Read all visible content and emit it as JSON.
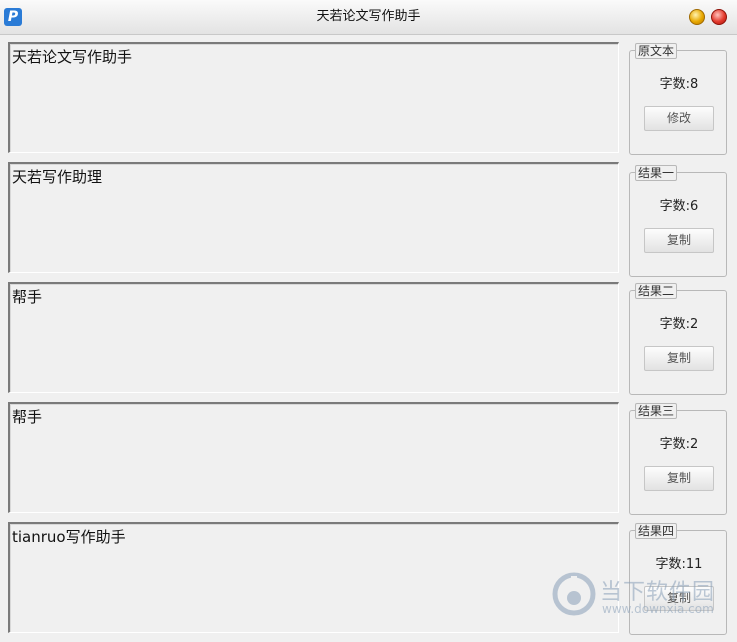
{
  "window": {
    "icon_letter": "P",
    "title": "天若论文写作助手"
  },
  "sections": [
    {
      "text": "天若论文写作助手",
      "legend": "原文本",
      "count": "字数:8",
      "button": "修改"
    },
    {
      "text": "天若写作助理",
      "legend": "结果一",
      "count": "字数:6",
      "button": "复制"
    },
    {
      "text": "帮手",
      "legend": "结果二",
      "count": "字数:2",
      "button": "复制"
    },
    {
      "text": "帮手",
      "legend": "结果三",
      "count": "字数:2",
      "button": "复制"
    },
    {
      "text": "tianruo写作助手",
      "legend": "结果四",
      "count": "字数:11",
      "button": "复制"
    }
  ],
  "watermark": {
    "name": "当下软件园",
    "url": "www.downxia.com"
  }
}
